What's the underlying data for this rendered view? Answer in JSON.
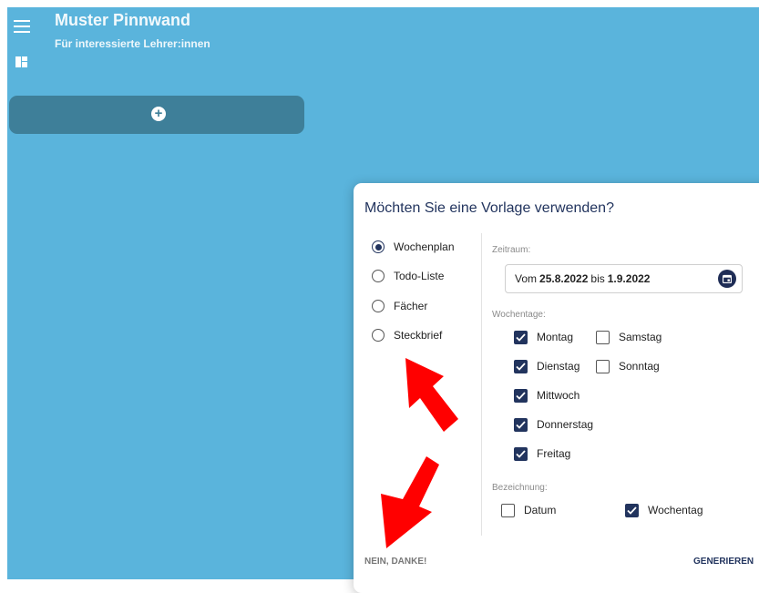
{
  "header": {
    "title": "Muster Pinnwand",
    "subtitle": "Für interessierte Lehrer:innen"
  },
  "dialog": {
    "title": "Möchten Sie eine Vorlage verwenden?",
    "templates": [
      {
        "label": "Wochenplan",
        "selected": true
      },
      {
        "label": "Todo-Liste",
        "selected": false
      },
      {
        "label": "Fächer",
        "selected": false
      },
      {
        "label": "Steckbrief",
        "selected": false
      }
    ],
    "zeitraum": {
      "label": "Zeitraum:",
      "prefix": "Vom",
      "from": "25.8.2022",
      "middle": "bis",
      "to": "1.9.2022"
    },
    "wochentage": {
      "label": "Wochentage:",
      "days": [
        {
          "label": "Montag",
          "checked": true
        },
        {
          "label": "Dienstag",
          "checked": true
        },
        {
          "label": "Mittwoch",
          "checked": true
        },
        {
          "label": "Donnerstag",
          "checked": true
        },
        {
          "label": "Freitag",
          "checked": true
        },
        {
          "label": "Samstag",
          "checked": false
        },
        {
          "label": "Sonntag",
          "checked": false
        }
      ]
    },
    "bezeichnung": {
      "label": "Bezeichnung:",
      "options": [
        {
          "label": "Datum",
          "checked": false
        },
        {
          "label": "Wochentag",
          "checked": true
        }
      ]
    },
    "cancel_label": "NEIN, DANKE!",
    "generate_label": "GENERIEREN"
  },
  "colors": {
    "board": "#5ab4dc",
    "add_column": "#3e7f99",
    "primary": "#22345e",
    "arrow": "#ff0000"
  },
  "icons": [
    "menu-icon",
    "layout-icon",
    "add-icon",
    "calendar-icon",
    "check-icon"
  ]
}
